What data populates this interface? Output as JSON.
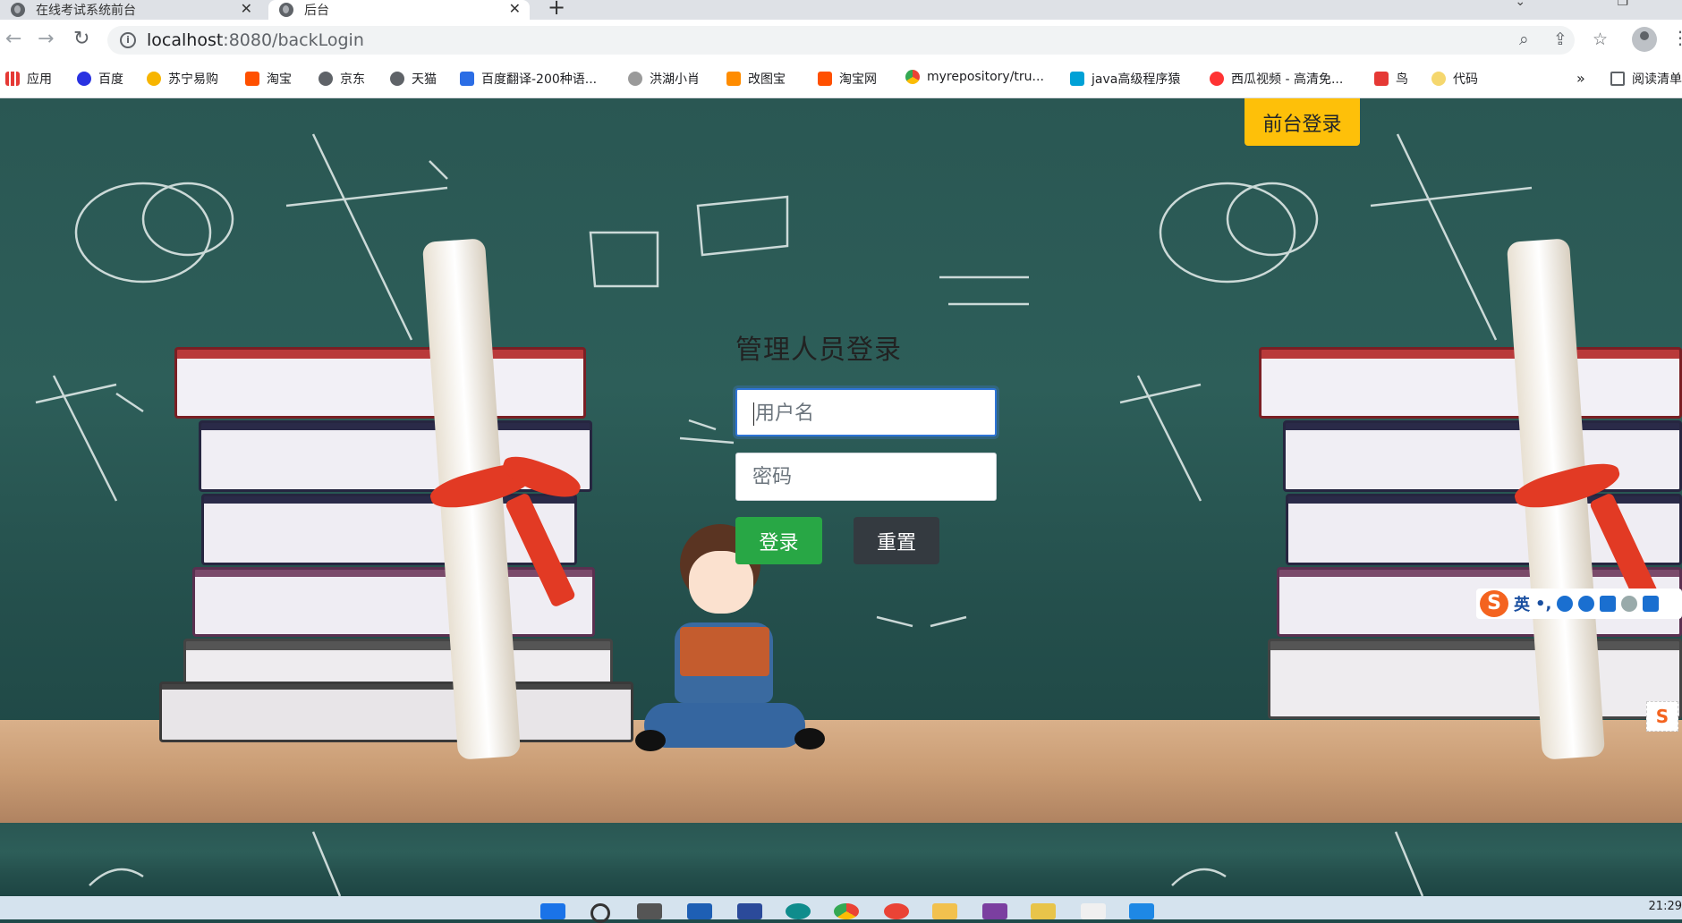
{
  "browser": {
    "tabs": [
      {
        "title": "在线考试系统前台"
      },
      {
        "title": "后台"
      }
    ],
    "url_host": "localhost",
    "url_rest": ":8080/backLogin",
    "bookmarks": [
      {
        "label": "应用",
        "color": "#e53935"
      },
      {
        "label": "百度",
        "color": "#2932e1"
      },
      {
        "label": "苏宁易购",
        "color": "#f7b500"
      },
      {
        "label": "淘宝",
        "color": "#ff5000"
      },
      {
        "label": "京东",
        "color": "#5f6368"
      },
      {
        "label": "天猫",
        "color": "#5f6368"
      },
      {
        "label": "百度翻译-200种语...",
        "color": "#2b6de5"
      },
      {
        "label": "洪湖小肖",
        "color": "#8a8a8a"
      },
      {
        "label": "改图宝",
        "color": "#ff8c00"
      },
      {
        "label": "淘宝网",
        "color": "#ff5000"
      },
      {
        "label": "myrepository/tru...",
        "color": "#34a853"
      },
      {
        "label": "java高级程序猿",
        "color": "#00a1d6"
      },
      {
        "label": "西瓜视频 - 高清免...",
        "color": "#f33"
      },
      {
        "label": "鸟",
        "color": "#e53935"
      },
      {
        "label": "代码",
        "color": "#f5d76e"
      }
    ],
    "overflow": "»",
    "reading_list": "阅读清单"
  },
  "page": {
    "front_login_label": "前台登录",
    "form_title": "管理人员登录",
    "username_placeholder": "用户名",
    "password_placeholder": "密码",
    "login_label": "登录",
    "reset_label": "重置"
  },
  "ime": {
    "logo": "S",
    "mode": "英"
  },
  "taskbar": {
    "clock": "21:29"
  },
  "colors": {
    "primary_warning": "#fec009",
    "success": "#28a745",
    "dark": "#343a40"
  }
}
